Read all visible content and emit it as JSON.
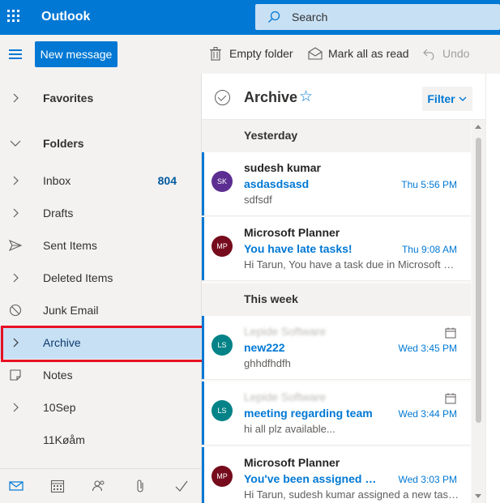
{
  "header": {
    "app_title": "Outlook",
    "search_placeholder": "Search"
  },
  "toolbar": {
    "new_message": "New message",
    "empty_folder": "Empty folder",
    "mark_all_read": "Mark all as read",
    "undo": "Undo"
  },
  "sidebar": {
    "favorites": "Favorites",
    "folders": "Folders",
    "items": [
      {
        "label": "Inbox",
        "count": "804"
      },
      {
        "label": "Drafts"
      },
      {
        "label": "Sent Items"
      },
      {
        "label": "Deleted Items"
      },
      {
        "label": "Junk Email"
      },
      {
        "label": "Archive"
      },
      {
        "label": "Notes"
      },
      {
        "label": "10Sep"
      },
      {
        "label": "11Køåm"
      }
    ]
  },
  "message_list": {
    "folder_title": "Archive",
    "filter_label": "Filter",
    "groups": [
      {
        "label": "Yesterday"
      },
      {
        "label": "This week"
      }
    ],
    "messages": [
      {
        "initials": "SK",
        "avatar_color": "#5c2e91",
        "sender": "sudesh kumar",
        "subject": "asdasdsasd",
        "time": "Thu 5:56 PM",
        "preview": "sdfsdf",
        "unread": true
      },
      {
        "initials": "MP",
        "avatar_color": "#750b1c",
        "sender": "Microsoft Planner",
        "subject": "You have late tasks!",
        "time": "Thu 9:08 AM",
        "preview": "Hi Tarun, You have a task due in Microsoft Planner",
        "unread": true
      },
      {
        "initials": "LS",
        "avatar_color": "#038387",
        "sender": "Lepide Software",
        "subject": "new222",
        "time": "Wed 3:45 PM",
        "preview": "ghhdfhdfh",
        "unread": true
      },
      {
        "initials": "LS",
        "avatar_color": "#038387",
        "sender": "Lepide Software",
        "subject": "meeting regarding team",
        "time": "Wed 3:44 PM",
        "preview": "hi all plz available...",
        "unread": true
      },
      {
        "initials": "MP",
        "avatar_color": "#750b1c",
        "sender": "Microsoft Planner",
        "subject": "You've been assigned a task",
        "time": "Wed 3:03 PM",
        "preview": "Hi Tarun, sudesh kumar assigned a new task to you",
        "unread": true
      }
    ]
  },
  "colors": {
    "brand": "#0078d4",
    "selected_bg": "#c7e0f4",
    "highlight": "#e81123"
  }
}
